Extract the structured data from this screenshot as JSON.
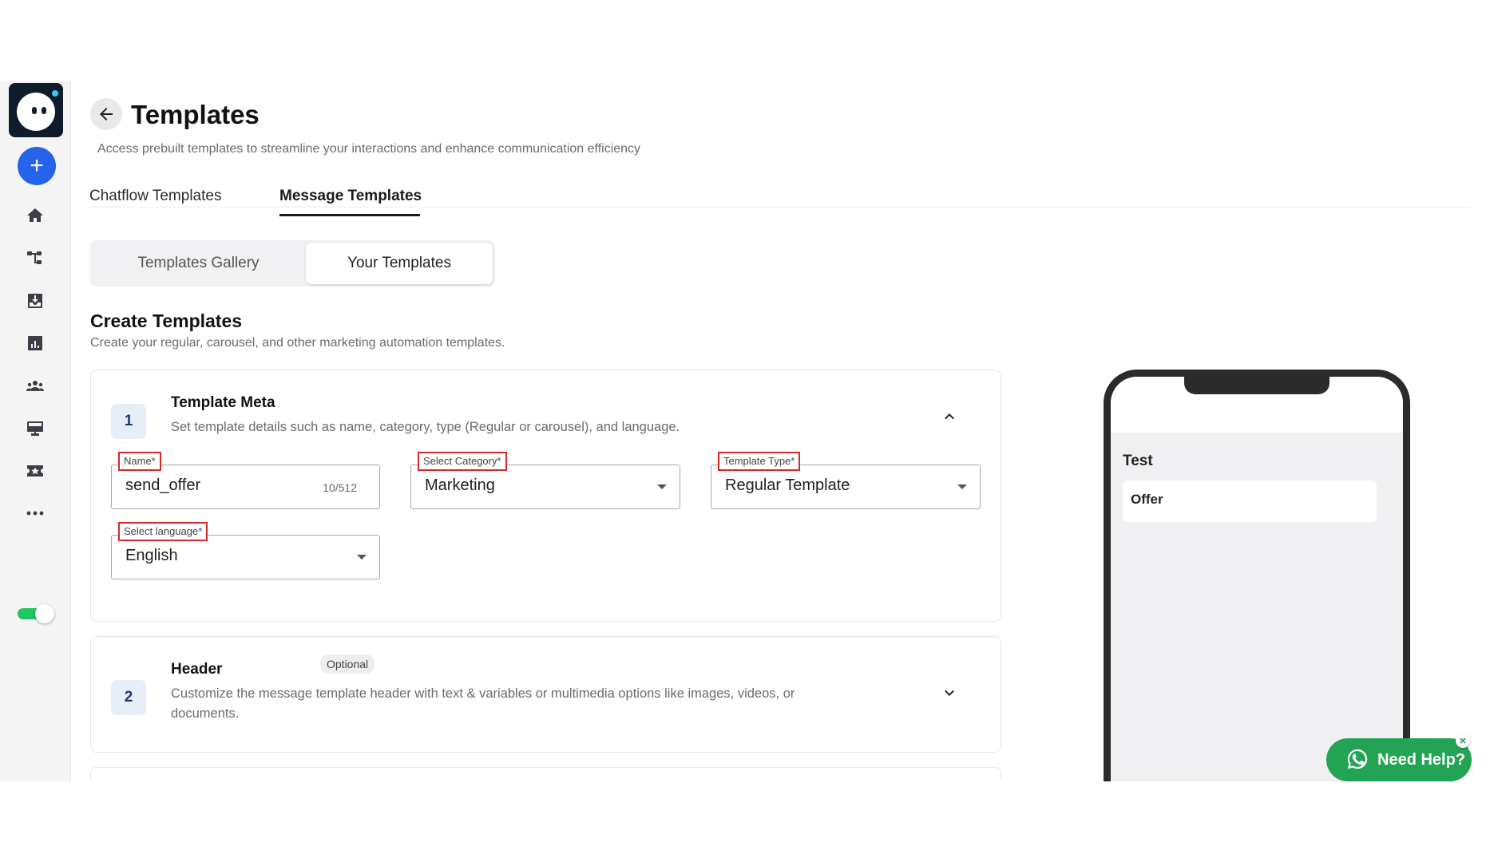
{
  "header": {
    "title": "Templates",
    "subtitle": "Access prebuilt templates to streamline your interactions and enhance communication efficiency"
  },
  "tabs": [
    {
      "label": "Chatflow Templates",
      "active": false
    },
    {
      "label": "Message Templates",
      "active": true
    }
  ],
  "segment": {
    "gallery_label": "Templates Gallery",
    "yours_label": "Your Templates",
    "selected": "Your Templates"
  },
  "section": {
    "title": "Create Templates",
    "subtitle": "Create your regular, carousel, and other marketing automation templates."
  },
  "meta_card": {
    "step": "1",
    "title": "Template Meta",
    "description": "Set template details such as name, category, type (Regular or carousel), and language.",
    "name_field": {
      "label": "Name*",
      "value": "send_offer",
      "counter": "10/512"
    },
    "category_field": {
      "label": "Select Category*",
      "value": "Marketing"
    },
    "type_field": {
      "label": "Template Type*",
      "value": "Regular Template"
    },
    "language_field": {
      "label": "Select language*",
      "value": "English"
    }
  },
  "header_card": {
    "step": "2",
    "title": "Header",
    "badge": "Optional",
    "description": "Customize the message template header with text & variables or multimedia options like images, videos, or documents."
  },
  "preview": {
    "name": "Test",
    "message": "Offer"
  },
  "help": {
    "label": "Need Help?",
    "close": "×"
  },
  "colors": {
    "accent": "#2563eb",
    "highlight_border": "#d42a2a",
    "help_green": "#23a455",
    "toggle_on": "#22c55e"
  },
  "icons": {
    "sidebar": [
      "home-icon",
      "flow-icon",
      "inbox-icon",
      "analytics-icon",
      "contacts-icon",
      "billboard-icon",
      "ticket-icon",
      "more-icon"
    ]
  }
}
